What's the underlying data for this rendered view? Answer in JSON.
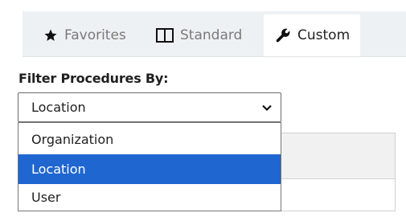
{
  "tabs": [
    {
      "label": "Favorites",
      "icon": "star-icon",
      "active": false
    },
    {
      "label": "Standard",
      "icon": "columns-icon",
      "active": false
    },
    {
      "label": "Custom",
      "icon": "wrench-icon",
      "active": true
    }
  ],
  "filter": {
    "label": "Filter Procedures By:",
    "selected": "Location",
    "options": [
      "Organization",
      "Location",
      "User"
    ]
  },
  "colors": {
    "selected_option_bg": "#1f66d1",
    "tab_bar_bg": "#eef1f3"
  }
}
